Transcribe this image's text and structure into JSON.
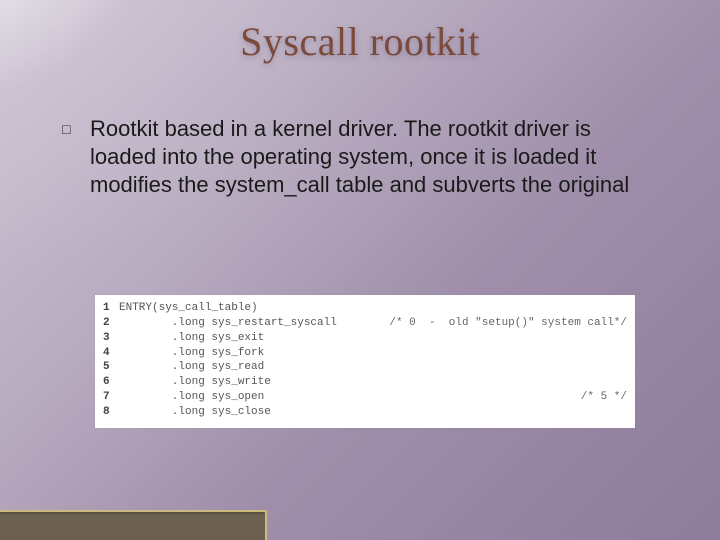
{
  "title": "Syscall rootkit",
  "bullet_marker": "□",
  "body_text": "Rootkit based in a kernel driver. The rootkit driver is loaded into the operating system, once it is loaded it modifies the system_call table and subverts the original",
  "code": {
    "lines": [
      {
        "n": "1",
        "text": "ENTRY(sys_call_table)",
        "comment": ""
      },
      {
        "n": "2",
        "text": "        .long sys_restart_syscall",
        "comment": "/* 0  -  old \"setup()\" system call*/"
      },
      {
        "n": "3",
        "text": "        .long sys_exit",
        "comment": ""
      },
      {
        "n": "4",
        "text": "        .long sys_fork",
        "comment": ""
      },
      {
        "n": "5",
        "text": "        .long sys_read",
        "comment": ""
      },
      {
        "n": "6",
        "text": "        .long sys_write",
        "comment": ""
      },
      {
        "n": "7",
        "text": "        .long sys_open",
        "comment": "/* 5 */"
      },
      {
        "n": "8",
        "text": "        .long sys_close",
        "comment": ""
      }
    ]
  }
}
